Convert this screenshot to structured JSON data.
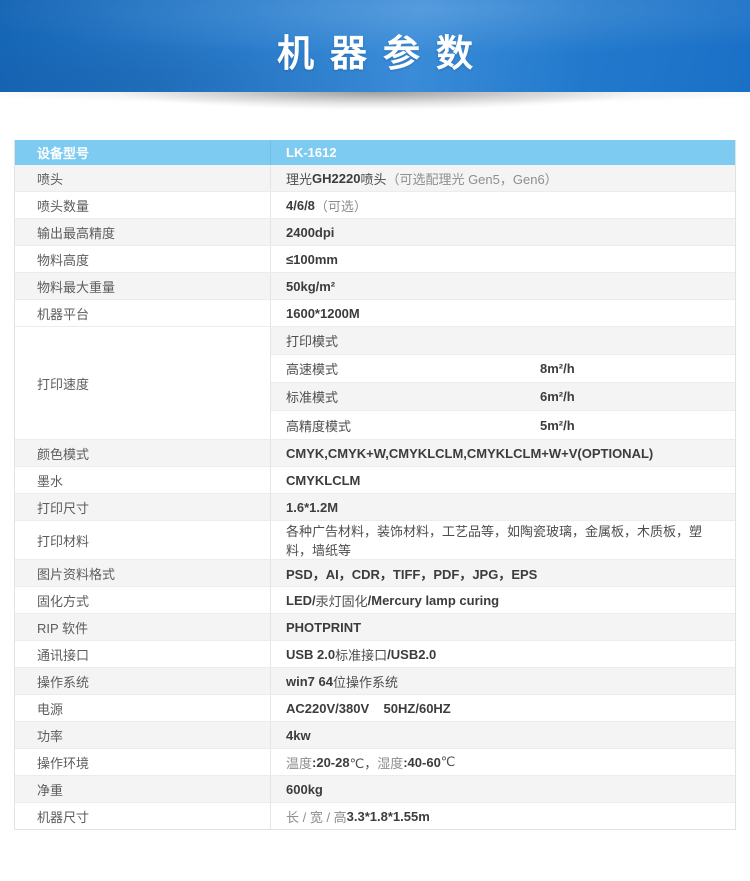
{
  "banner": {
    "title": "机器参数"
  },
  "colors": {
    "banner_blue_dark": "#1565b5",
    "banner_blue_light": "#3a8cd8",
    "table_header_blue": "#7ecbf1",
    "stripe_gray": "#f4f4f4",
    "border_gray": "#e5e5e5",
    "value_bold_text": "#3c3c3c",
    "label_text": "#5d5d5d"
  },
  "table": {
    "header": {
      "label": "设备型号",
      "value": "LK-1612"
    },
    "rows": [
      {
        "type": "simple",
        "label": "喷头",
        "segments": [
          [
            "r",
            "理光 "
          ],
          [
            "b",
            "GH2220"
          ],
          [
            "r",
            " 喷头"
          ],
          [
            "l",
            "（可选配理光 Gen5，Gen6）"
          ]
        ]
      },
      {
        "type": "simple",
        "label": "喷头数量",
        "segments": [
          [
            "b",
            "4/6/8"
          ],
          [
            "l",
            "（可选）"
          ]
        ]
      },
      {
        "type": "simple",
        "label": "输出最高精度",
        "segments": [
          [
            "b",
            "2400dpi"
          ]
        ]
      },
      {
        "type": "simple",
        "label": "物料高度",
        "segments": [
          [
            "b",
            "≤100mm"
          ]
        ]
      },
      {
        "type": "simple",
        "label": "物料最大重量",
        "segments": [
          [
            "b",
            "50kg/m²"
          ]
        ]
      },
      {
        "type": "simple",
        "label": "机器平台",
        "segments": [
          [
            "b",
            "1600*1200M"
          ]
        ]
      },
      {
        "type": "group",
        "label": "打印速度",
        "subrows": [
          {
            "mode": "打印模式",
            "value": ""
          },
          {
            "mode": "高速模式",
            "value": "8m²/h"
          },
          {
            "mode": "标准模式",
            "value": "6m²/h"
          },
          {
            "mode": "高精度模式",
            "value": "5m²/h"
          }
        ]
      },
      {
        "type": "simple",
        "label": "颜色模式",
        "segments": [
          [
            "b",
            "CMYK,CMYK+W,CMYKLCLM,CMYKLCLM+W+V(OPTIONAL)"
          ]
        ]
      },
      {
        "type": "simple",
        "label": "墨水",
        "segments": [
          [
            "b",
            "CMYKLCLM"
          ]
        ]
      },
      {
        "type": "simple",
        "label": "打印尺寸",
        "segments": [
          [
            "b",
            "1.6*1.2M"
          ]
        ]
      },
      {
        "type": "simple",
        "label": "打印材料",
        "segments": [
          [
            "r",
            "各种广告材料，装饰材料，工艺品等，如陶瓷玻璃，金属板，木质板，塑料，墙纸等"
          ]
        ]
      },
      {
        "type": "simple",
        "label": "图片资料格式",
        "segments": [
          [
            "b",
            "PSD，AI，CDR，TIFF，PDF，JPG，EPS"
          ]
        ]
      },
      {
        "type": "simple",
        "label": "固化方式",
        "segments": [
          [
            "b",
            "LED/ "
          ],
          [
            "r",
            "汞灯固化 "
          ],
          [
            "b",
            "/Mercury lamp curing"
          ]
        ]
      },
      {
        "type": "simple",
        "label": "RIP 软件",
        "segments": [
          [
            "b",
            "PHOTPRINT"
          ]
        ]
      },
      {
        "type": "simple",
        "label": "通讯接口",
        "segments": [
          [
            "b",
            "USB 2.0 "
          ],
          [
            "r",
            "标准接口 "
          ],
          [
            "b",
            "/USB2.0"
          ]
        ]
      },
      {
        "type": "simple",
        "label": "操作系统",
        "segments": [
          [
            "b",
            "win7 64 "
          ],
          [
            "r",
            "位操作系统"
          ]
        ]
      },
      {
        "type": "simple",
        "label": "电源",
        "segments": [
          [
            "b",
            "AC220V/380V    50HZ/60HZ"
          ]
        ]
      },
      {
        "type": "simple",
        "label": "功率",
        "segments": [
          [
            "b",
            "4kw"
          ]
        ]
      },
      {
        "type": "simple",
        "label": "操作环境",
        "segments": [
          [
            "l",
            "温度 "
          ],
          [
            "b",
            ":20-28"
          ],
          [
            "r",
            "℃，"
          ],
          [
            "l",
            "湿度 "
          ],
          [
            "b",
            ":40-60"
          ],
          [
            "r",
            "℃"
          ]
        ]
      },
      {
        "type": "simple",
        "label": "净重",
        "segments": [
          [
            "b",
            "600kg"
          ]
        ]
      },
      {
        "type": "simple",
        "label": "机器尺寸",
        "segments": [
          [
            "l",
            "长 / 宽 / 高 "
          ],
          [
            "b",
            "3.3*1.8*1.55m"
          ]
        ]
      }
    ]
  }
}
